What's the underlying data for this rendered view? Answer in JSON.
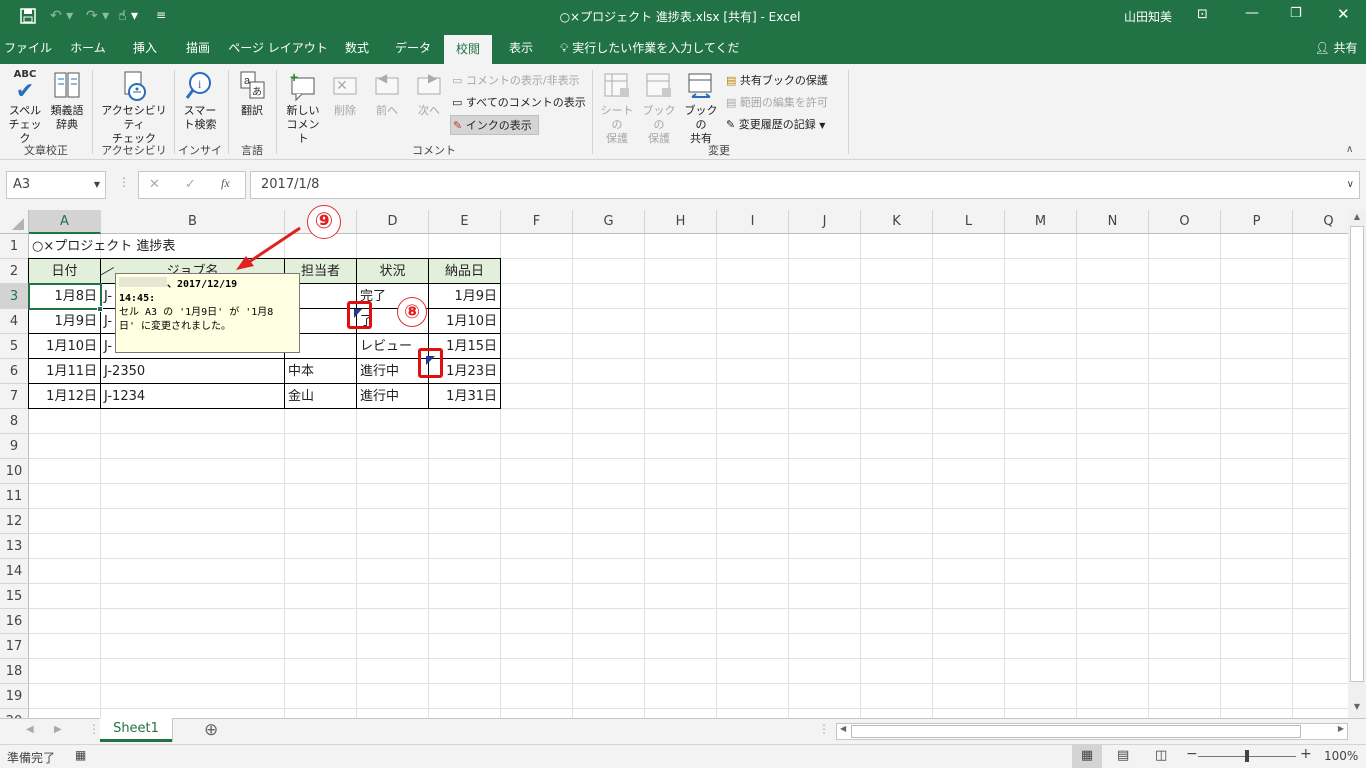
{
  "window": {
    "title": "○×プロジェクト  進捗表.xlsx  [共有]  -  Excel",
    "user": "山田知美"
  },
  "tabs": [
    "ファイル",
    "ホーム",
    "挿入",
    "描画",
    "ページ レイアウト",
    "数式",
    "データ",
    "校閲",
    "表示"
  ],
  "active_tab": "校閲",
  "tell_me": "実行したい作業を入力してください",
  "share": "共有",
  "ribbon": {
    "spell": "スペル\nチェック",
    "spell_abc": "ABC",
    "thesaurus": "類義語\n辞典",
    "accessibility": "アクセシビリティ\nチェック",
    "smart": "スマー\nト検索",
    "translate": "翻訳",
    "new_comment": "新しい\nコメント",
    "delete": "削除",
    "prev": "前へ",
    "next": "次へ",
    "show_hide_comment": "コメントの表示/非表示",
    "show_all_comments": "すべてのコメントの表示",
    "show_ink": "インクの表示",
    "protect_sheet": "シートの\n保護",
    "protect_book": "ブックの\n保護",
    "share_book": "ブックの\n共有",
    "protect_shared": "共有ブックの保護",
    "allow_edit": "範囲の編集を許可",
    "track_changes": "変更履歴の記録",
    "groups": {
      "proofing": "文章校正",
      "accessibility": "アクセシビリティ",
      "insights": "インサイト",
      "language": "言語",
      "comments": "コメント",
      "changes": "変更"
    }
  },
  "formula_bar": {
    "name_box": "A3",
    "formula": "2017/1/8",
    "fx": "fx"
  },
  "columns": [
    "A",
    "B",
    "C",
    "D",
    "E",
    "F",
    "G",
    "H",
    "I",
    "J",
    "K",
    "L",
    "M",
    "N",
    "O",
    "P",
    "Q"
  ],
  "rows": [
    "1",
    "2",
    "3",
    "4",
    "5",
    "6",
    "7",
    "8",
    "9",
    "10",
    "11",
    "12",
    "13",
    "14",
    "15",
    "16",
    "17",
    "18",
    "19",
    "20"
  ],
  "cells": {
    "a1": "○×プロジェクト  進捗表",
    "headers": [
      "日付",
      "ジョブ名",
      "担当者",
      "状況",
      "納品日"
    ],
    "data": [
      [
        "1月8日",
        "J-",
        "田",
        "完了",
        "1月9日"
      ],
      [
        "1月9日",
        "J-",
        "",
        "了",
        "1月10日"
      ],
      [
        "1月10日",
        "J-",
        "口",
        "レビュー",
        "1月15日"
      ],
      [
        "1月11日",
        "J-2350",
        "中本",
        "進行中",
        "1月23日"
      ],
      [
        "1月12日",
        "J-1234",
        "金山",
        "進行中",
        "1月31日"
      ]
    ]
  },
  "comment": {
    "line1": "、2017/12/19",
    "line2": "14:45:",
    "line3": "セル A3 の '1月9日' が '1月8",
    "line4": "日' に変更されました。"
  },
  "callouts": {
    "nine": "⑨",
    "eight": "⑧"
  },
  "sheet": {
    "tab": "Sheet1",
    "add": "⊕"
  },
  "status": {
    "ready": "準備完了",
    "zoom": "100%"
  },
  "colors": {
    "accent": "#217346",
    "callout_red": "#e01010",
    "header_fill": "#e2efda",
    "comment_bg": "#ffffe1"
  }
}
